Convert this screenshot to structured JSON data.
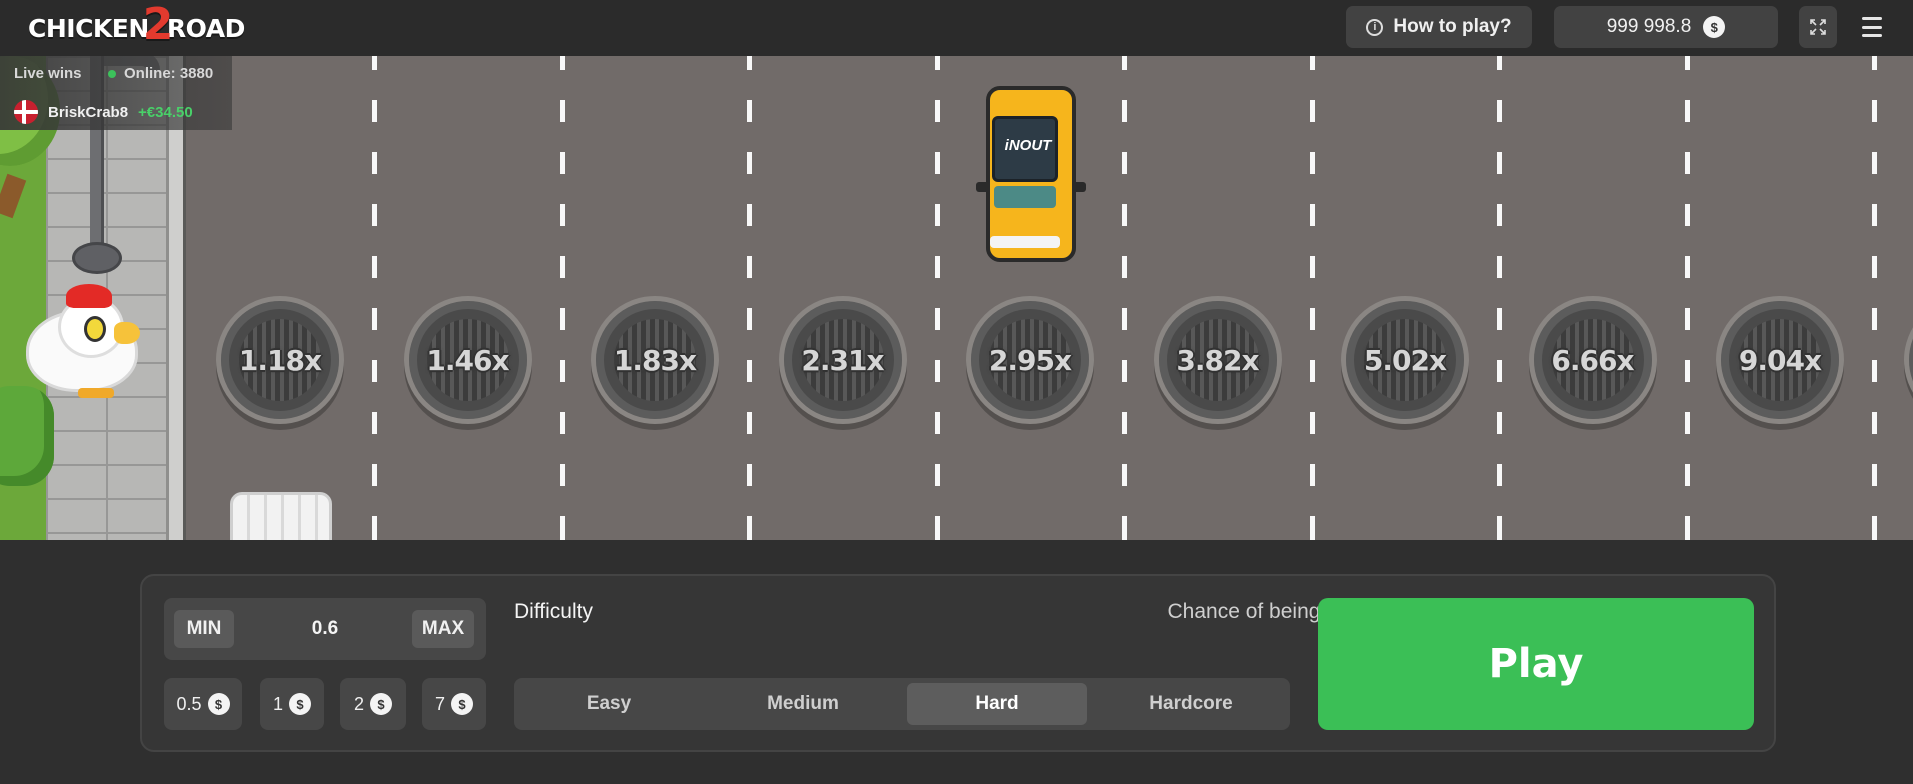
{
  "header": {
    "logo_text_a": "CHICKEN",
    "logo_text_b": "2",
    "logo_text_c": "ROAD",
    "how_to_play_label": "How to play?",
    "balance": "999 998.8",
    "currency_symbol": "$"
  },
  "live_wins": {
    "label": "Live wins",
    "online_label": "Online: 3880",
    "latest_win": {
      "user": "BriskCrab8",
      "amount": "+€34.50"
    }
  },
  "road": {
    "multipliers": [
      "1.18x",
      "1.46x",
      "1.83x",
      "2.31x",
      "2.95x",
      "3.82x",
      "5.02x",
      "6.66x",
      "9.04x"
    ],
    "car_logo": "iNOUT"
  },
  "controls": {
    "min_label": "MIN",
    "max_label": "MAX",
    "bet_value": "0.6",
    "quick_bets": [
      "0.5",
      "1",
      "2",
      "7"
    ],
    "difficulty_label": "Difficulty",
    "chance_label": "Chance of being shot down",
    "difficulties": [
      "Easy",
      "Medium",
      "Hard",
      "Hardcore"
    ],
    "selected_difficulty": "Hard",
    "play_label": "Play"
  },
  "colors": {
    "play": "#3bbf56",
    "win_amount": "#49d069",
    "road": "#716b69",
    "panel": "#363636"
  },
  "icons": [
    "info-icon",
    "coin-icon",
    "fullscreen-icon",
    "menu-icon"
  ]
}
